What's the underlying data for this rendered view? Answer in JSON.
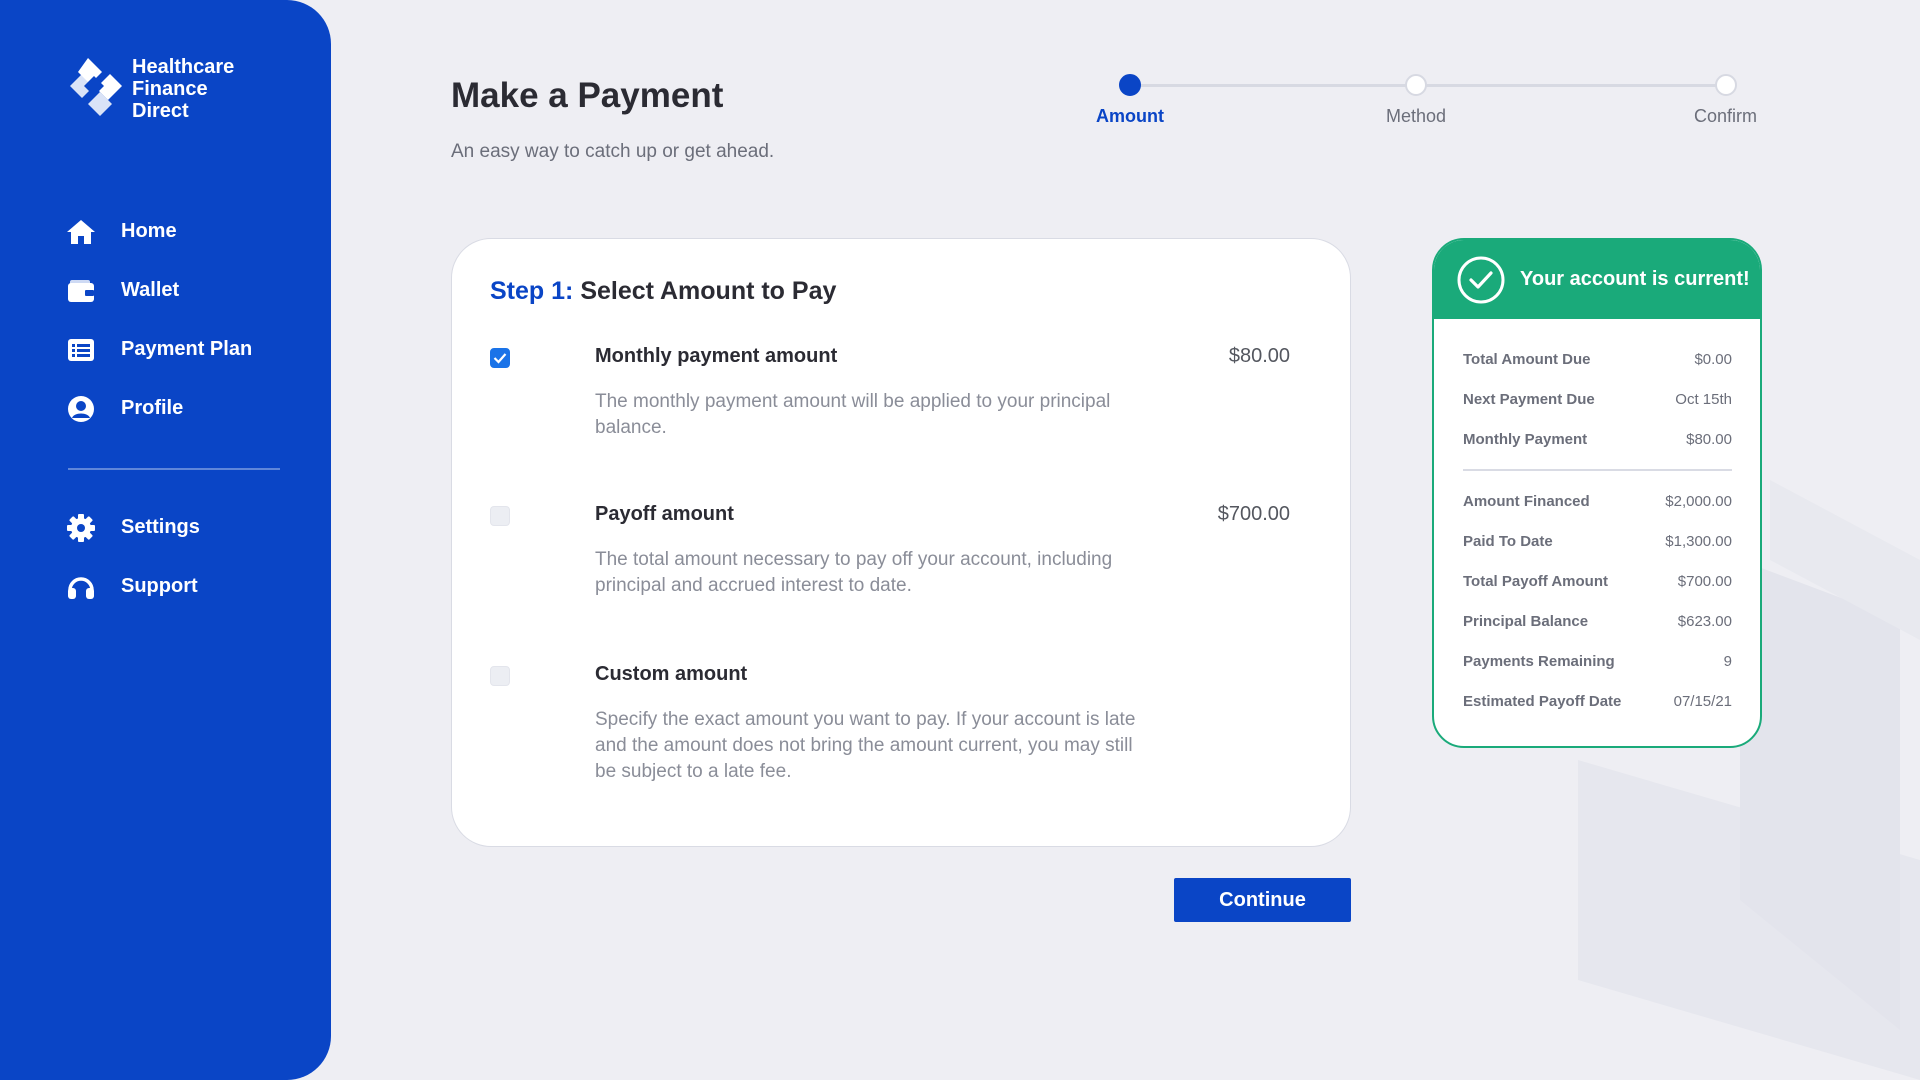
{
  "brand": {
    "name_lines": [
      "Healthcare",
      "Finance",
      "Direct"
    ],
    "primary_color": "#0a45c6",
    "success_color": "#1aaa7a"
  },
  "sidebar": {
    "items": [
      {
        "label": "Home",
        "icon": "home-icon"
      },
      {
        "label": "Wallet",
        "icon": "wallet-icon"
      },
      {
        "label": "Payment Plan",
        "icon": "list-icon"
      },
      {
        "label": "Profile",
        "icon": "user-circle-icon"
      }
    ],
    "secondary_items": [
      {
        "label": "Settings",
        "icon": "gear-icon"
      },
      {
        "label": "Support",
        "icon": "headphones-icon"
      }
    ]
  },
  "header": {
    "title": "Make a Payment",
    "subtitle": "An easy way to catch up or get ahead."
  },
  "stepper": {
    "steps": [
      {
        "label": "Amount",
        "active": true
      },
      {
        "label": "Method",
        "active": false
      },
      {
        "label": "Confirm",
        "active": false
      }
    ]
  },
  "card": {
    "step_label": "Step 1:",
    "title": "Select Amount to Pay",
    "options": [
      {
        "title": "Monthly payment amount",
        "amount": "$80.00",
        "checked": true,
        "description": "The monthly payment amount will be applied to your principal balance."
      },
      {
        "title": "Payoff amount",
        "amount": "$700.00",
        "checked": false,
        "description": "The total amount necessary to pay off your account, including principal and accrued interest to date."
      },
      {
        "title": "Custom amount",
        "amount": "",
        "checked": false,
        "description": "Specify the exact amount you want to pay. If your account is late and the amount does not bring the amount current, you may still be subject to a late fee."
      }
    ]
  },
  "continue_label": "Continue",
  "summary": {
    "title": "Your account is current!",
    "rows_top": [
      {
        "label": "Total Amount Due",
        "value": "$0.00"
      },
      {
        "label": "Next Payment Due",
        "value": "Oct 15th"
      },
      {
        "label": "Monthly Payment",
        "value": "$80.00"
      }
    ],
    "rows_bottom": [
      {
        "label": "Amount Financed",
        "value": "$2,000.00"
      },
      {
        "label": "Paid To Date",
        "value": "$1,300.00"
      },
      {
        "label": "Total Payoff Amount",
        "value": "$700.00"
      },
      {
        "label": "Principal Balance",
        "value": "$623.00"
      },
      {
        "label": "Payments Remaining",
        "value": "9"
      },
      {
        "label": "Estimated Payoff Date",
        "value": "07/15/21"
      }
    ]
  }
}
